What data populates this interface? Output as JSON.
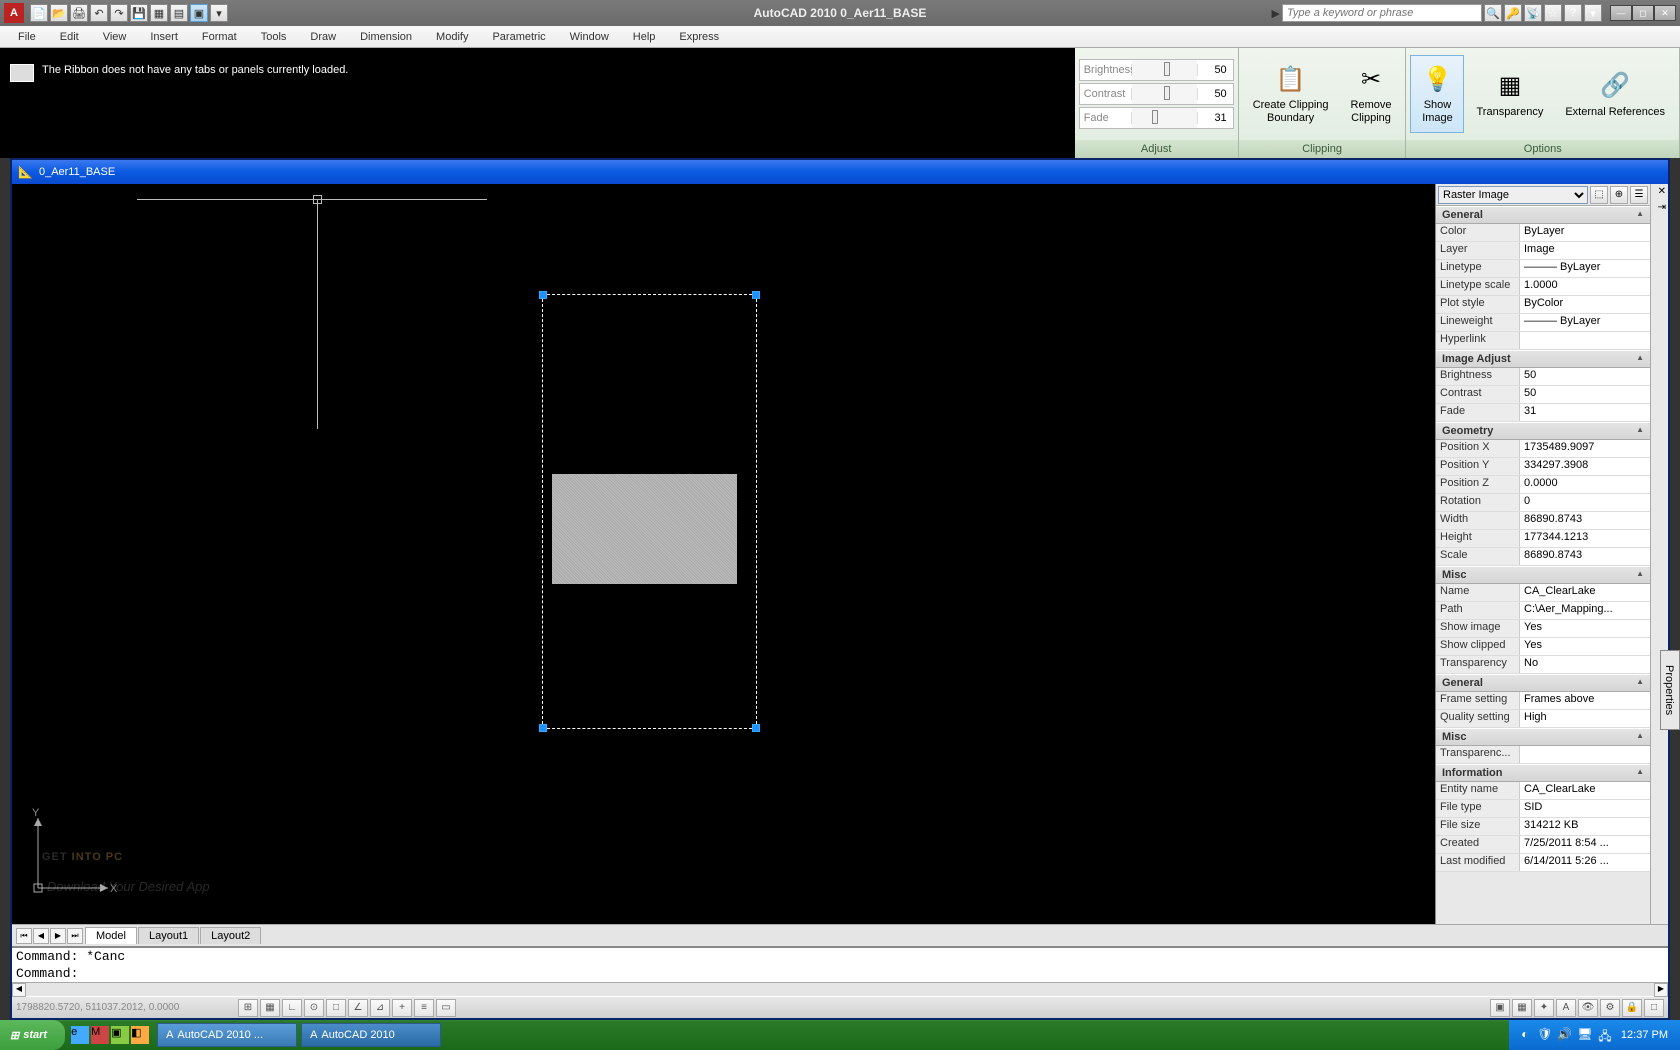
{
  "title": "AutoCAD 2010   0_Aer11_BASE",
  "search_placeholder": "Type a keyword or phrase",
  "menus": [
    "File",
    "Edit",
    "View",
    "Insert",
    "Format",
    "Tools",
    "Draw",
    "Dimension",
    "Modify",
    "Parametric",
    "Window",
    "Help",
    "Express"
  ],
  "ribbon_message": "The Ribbon does not have any tabs or panels currently loaded.",
  "adjust": {
    "title": "Adjust",
    "sliders": [
      {
        "label": "Brightness",
        "value": "50",
        "pos": 50
      },
      {
        "label": "Contrast",
        "value": "50",
        "pos": 50
      },
      {
        "label": "Fade",
        "value": "31",
        "pos": 31
      }
    ]
  },
  "clipping": {
    "title": "Clipping",
    "buttons": [
      {
        "label": "Create Clipping\nBoundary"
      },
      {
        "label": "Remove\nClipping"
      }
    ]
  },
  "options": {
    "title": "Options",
    "buttons": [
      {
        "label": "Show\nImage",
        "active": true
      },
      {
        "label": "Transparency"
      },
      {
        "label": "External References"
      }
    ]
  },
  "doc_title": "0_Aer11_BASE",
  "layout_tabs": [
    "Model",
    "Layout1",
    "Layout2"
  ],
  "cmd_lines": [
    "Command: *Cancel*",
    "Command:"
  ],
  "cmd1_display": "Command: *Canc",
  "cmd2_display": "Command:",
  "status_coords": "1798820.5720, 511037.2012, 0.0000",
  "props_selector": "Raster Image",
  "props": {
    "General": [
      {
        "k": "Color",
        "v": "ByLayer"
      },
      {
        "k": "Layer",
        "v": "Image"
      },
      {
        "k": "Linetype",
        "v": "——— ByLayer"
      },
      {
        "k": "Linetype scale",
        "v": "1.0000"
      },
      {
        "k": "Plot style",
        "v": "ByColor"
      },
      {
        "k": "Lineweight",
        "v": "——— ByLayer"
      },
      {
        "k": "Hyperlink",
        "v": ""
      }
    ],
    "Image Adjust": [
      {
        "k": "Brightness",
        "v": "50"
      },
      {
        "k": "Contrast",
        "v": "50"
      },
      {
        "k": "Fade",
        "v": "31"
      }
    ],
    "Geometry": [
      {
        "k": "Position X",
        "v": "1735489.9097"
      },
      {
        "k": "Position Y",
        "v": "334297.3908"
      },
      {
        "k": "Position Z",
        "v": "0.0000"
      },
      {
        "k": "Rotation",
        "v": "0"
      },
      {
        "k": "Width",
        "v": "86890.8743"
      },
      {
        "k": "Height",
        "v": "177344.1213"
      },
      {
        "k": "Scale",
        "v": "86890.8743"
      }
    ],
    "Misc": [
      {
        "k": "Name",
        "v": "CA_ClearLake"
      },
      {
        "k": "Path",
        "v": "C:\\Aer_Mapping..."
      },
      {
        "k": "Show image",
        "v": "Yes"
      },
      {
        "k": "Show clipped",
        "v": "Yes"
      },
      {
        "k": "Transparency",
        "v": "No"
      }
    ],
    "General2": [
      {
        "k": "Frame setting",
        "v": "Frames above"
      },
      {
        "k": "Quality setting",
        "v": "High"
      }
    ],
    "Misc2": [
      {
        "k": "Transparenc...",
        "v": ""
      }
    ],
    "Information": [
      {
        "k": "Entity name",
        "v": "CA_ClearLake"
      },
      {
        "k": "File type",
        "v": "SID"
      },
      {
        "k": "File size",
        "v": "314212 KB"
      },
      {
        "k": "Created",
        "v": "7/25/2011 8:54 ..."
      },
      {
        "k": "Last modified",
        "v": "6/14/2011 5:26 ..."
      }
    ]
  },
  "props_side_label": "Properties",
  "watermark": {
    "part1": "GET ",
    "part2": "INTO PC",
    "sub": "Download Your Desired App"
  },
  "taskbar": {
    "start": "start",
    "tasks": [
      {
        "label": "AutoCAD 2010 ...",
        "active": true
      },
      {
        "label": "AutoCAD 2010",
        "active": false
      }
    ],
    "clock": "12:37 PM"
  }
}
